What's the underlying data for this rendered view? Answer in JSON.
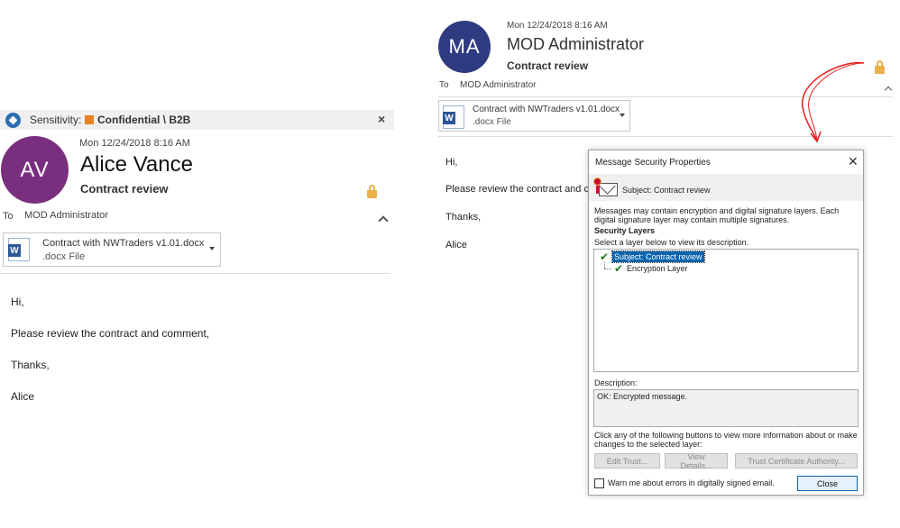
{
  "left_message": {
    "sensitivity_label": "Sensitivity:",
    "sensitivity_value": "Confidential \\ B2B",
    "close_glyph": "×",
    "avatar_initials": "AV",
    "avatar_color": "#7a2f7e",
    "date": "Mon 12/24/2018 8:16 AM",
    "sender": "Alice Vance",
    "subject": "Contract review",
    "to_label": "To",
    "recipient": "MOD Administrator",
    "attachment_name": "Contract with NWTraders v1.01.docx",
    "attachment_type": ".docx File",
    "body": [
      "Hi,",
      "Please review the contract and comment,",
      "Thanks,",
      "Alice"
    ]
  },
  "right_message": {
    "avatar_initials": "MA",
    "avatar_color": "#2f3b80",
    "date": "Mon 12/24/2018 8:16 AM",
    "sender": "MOD Administrator",
    "subject": "Contract review",
    "to_label": "To",
    "recipient": "MOD Administrator",
    "attachment_name": "Contract with NWTraders v1.01.docx",
    "attachment_type": ".docx File",
    "body": [
      "Hi,",
      "Please review the contract and c",
      "Thanks,",
      "Alice"
    ]
  },
  "dialog": {
    "title": "Message Security Properties",
    "close_glyph": "✕",
    "subject_line": "Subject:  Contract review",
    "description": "Messages may contain encryption and digital signature layers. Each digital signature layer may contain multiple signatures.",
    "security_layers_heading": "Security Layers",
    "security_layers_hint": "Select a layer below to view its description.",
    "layers": [
      "Subject: Contract review",
      "Encryption Layer"
    ],
    "description_label": "Description:",
    "description_text": "OK: Encrypted message.",
    "click_info": "Click any of the following buttons to view more information about or make changes to the selected layer:",
    "buttons": {
      "edit_trust": "Edit Trust...",
      "view_details": "View Details...",
      "trust_ca": "Trust Certificate Authority...",
      "close": "Close"
    },
    "warn_checkbox_label": "Warn me about errors in digitally signed email."
  },
  "colors": {
    "sensitivity_swatch": "#e8821e",
    "lock": "#e9b04c",
    "selection": "#0a64ad",
    "arrow": "#e0201a"
  },
  "icons": [
    "sensitivity-tag-icon",
    "lock-icon",
    "word-document-icon",
    "chevron-up-icon",
    "dropdown-caret-icon",
    "envelope-seal-icon",
    "checkmark-icon",
    "close-icon",
    "curved-arrow-icon"
  ]
}
